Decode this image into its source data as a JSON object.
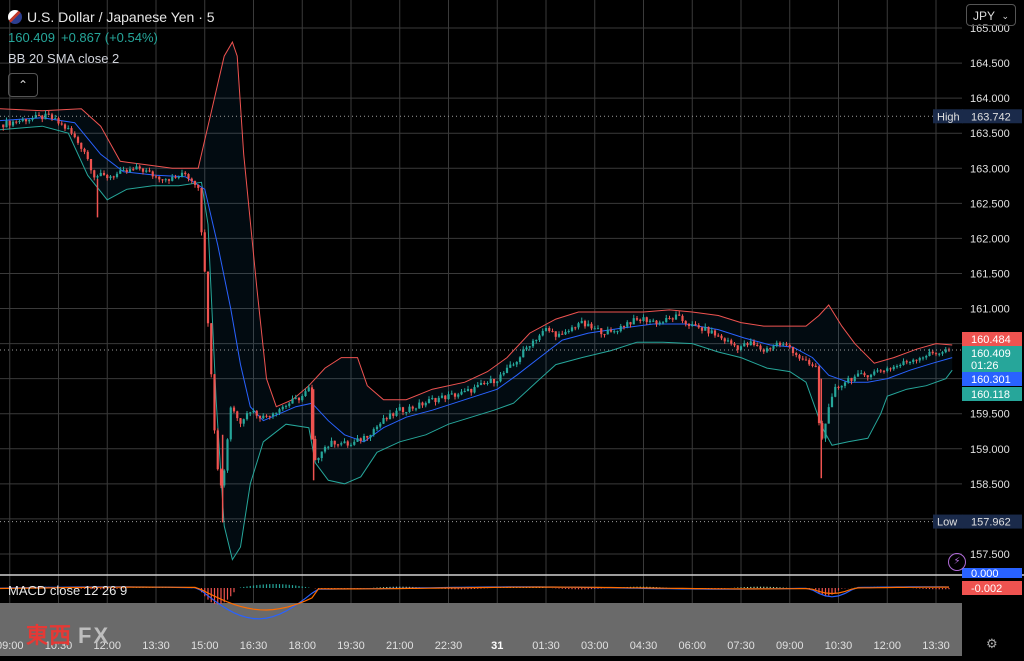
{
  "header": {
    "title": "U.S. Dollar / Japanese Yen · 5",
    "price": "160.409",
    "change": "+0.867 (+0.54%)",
    "indicator": "BB 20 SMA close 2",
    "collapse_icon": "chevron-up-icon"
  },
  "currency_selector": {
    "label": "JPY"
  },
  "macd_label": "MACD close 12 26 9",
  "logo": {
    "text": "東西",
    "fx": "FX"
  },
  "colors": {
    "up": "#26a69a",
    "down": "#ef5350",
    "upper_band": "#ef5350",
    "lower_band": "#26a69a",
    "basis": "#2962ff",
    "macd": "#2962ff",
    "signal": "#ff6d00"
  },
  "chart_data": {
    "type": "candlestick",
    "title": "U.S. Dollar / Japanese Yen · 5",
    "ylim": [
      157.2,
      165.4
    ],
    "y_ticks": [
      157.5,
      158.0,
      158.5,
      159.0,
      159.5,
      160.0,
      160.5,
      161.0,
      161.5,
      162.0,
      162.5,
      163.0,
      163.5,
      164.0,
      164.5,
      165.0
    ],
    "y_tick_labels": [
      "157.500",
      "158.000",
      "158.500",
      "159.000",
      "159.500",
      "160.000",
      "160.500",
      "161.000",
      "161.500",
      "162.000",
      "162.500",
      "163.000",
      "163.500",
      "164.000",
      "164.500",
      "165.000"
    ],
    "x_ticks": [
      {
        "label": "09:00",
        "pos": 0.0
      },
      {
        "label": "10:30",
        "pos": 1.5
      },
      {
        "label": "12:00",
        "pos": 3.0
      },
      {
        "label": "13:30",
        "pos": 4.5
      },
      {
        "label": "15:00",
        "pos": 6.0
      },
      {
        "label": "16:30",
        "pos": 7.5
      },
      {
        "label": "18:00",
        "pos": 9.0
      },
      {
        "label": "19:30",
        "pos": 10.5
      },
      {
        "label": "21:00",
        "pos": 12.0
      },
      {
        "label": "22:30",
        "pos": 13.5
      },
      {
        "label": "31",
        "pos": 15.0
      },
      {
        "label": "01:30",
        "pos": 16.5
      },
      {
        "label": "03:00",
        "pos": 18.0
      },
      {
        "label": "04:30",
        "pos": 19.5
      },
      {
        "label": "06:00",
        "pos": 21.0
      },
      {
        "label": "07:30",
        "pos": 22.5
      },
      {
        "label": "09:00",
        "pos": 24.0
      },
      {
        "label": "10:30",
        "pos": 25.5
      },
      {
        "label": "12:00",
        "pos": 27.0
      },
      {
        "label": "13:30",
        "pos": 28.5
      }
    ],
    "x_range": [
      -0.3,
      29.3
    ],
    "close_path": [
      [
        -0.3,
        163.62
      ],
      [
        0.5,
        163.7
      ],
      [
        1.2,
        163.74
      ],
      [
        1.8,
        163.55
      ],
      [
        2.3,
        163.25
      ],
      [
        2.6,
        162.9
      ],
      [
        3.0,
        162.88
      ],
      [
        3.6,
        162.95
      ],
      [
        4.0,
        163.0
      ],
      [
        4.5,
        162.88
      ],
      [
        5.0,
        162.85
      ],
      [
        5.4,
        162.92
      ],
      [
        5.8,
        162.75
      ],
      [
        6.0,
        161.5
      ],
      [
        6.15,
        160.5
      ],
      [
        6.3,
        159.3
      ],
      [
        6.45,
        158.4
      ],
      [
        6.6,
        158.7
      ],
      [
        6.8,
        159.6
      ],
      [
        7.1,
        159.4
      ],
      [
        7.4,
        159.55
      ],
      [
        7.8,
        159.45
      ],
      [
        8.2,
        159.55
      ],
      [
        8.6,
        159.65
      ],
      [
        9.0,
        159.75
      ],
      [
        9.2,
        159.85
      ],
      [
        9.35,
        158.75
      ],
      [
        9.6,
        159.0
      ],
      [
        10.0,
        159.1
      ],
      [
        10.5,
        159.05
      ],
      [
        11.0,
        159.2
      ],
      [
        11.5,
        159.4
      ],
      [
        12.0,
        159.55
      ],
      [
        12.5,
        159.6
      ],
      [
        13.0,
        159.7
      ],
      [
        13.5,
        159.75
      ],
      [
        14.0,
        159.8
      ],
      [
        14.5,
        159.9
      ],
      [
        15.0,
        160.0
      ],
      [
        15.5,
        160.2
      ],
      [
        16.0,
        160.5
      ],
      [
        16.5,
        160.7
      ],
      [
        17.0,
        160.6
      ],
      [
        17.5,
        160.8
      ],
      [
        18.0,
        160.7
      ],
      [
        18.5,
        160.65
      ],
      [
        19.0,
        160.8
      ],
      [
        19.5,
        160.85
      ],
      [
        20.0,
        160.8
      ],
      [
        20.5,
        160.88
      ],
      [
        21.0,
        160.75
      ],
      [
        21.5,
        160.68
      ],
      [
        22.0,
        160.55
      ],
      [
        22.4,
        160.45
      ],
      [
        22.8,
        160.5
      ],
      [
        23.2,
        160.4
      ],
      [
        23.6,
        160.5
      ],
      [
        24.0,
        160.45
      ],
      [
        24.4,
        160.25
      ],
      [
        24.8,
        160.15
      ],
      [
        24.95,
        159.0
      ],
      [
        25.1,
        159.4
      ],
      [
        25.4,
        159.85
      ],
      [
        25.8,
        160.0
      ],
      [
        26.3,
        160.05
      ],
      [
        26.8,
        160.12
      ],
      [
        27.3,
        160.18
      ],
      [
        27.8,
        160.28
      ],
      [
        28.3,
        160.35
      ],
      [
        28.8,
        160.4
      ],
      [
        29.0,
        160.41
      ]
    ],
    "upper_band": [
      [
        -0.3,
        163.85
      ],
      [
        1.0,
        163.82
      ],
      [
        2.2,
        163.85
      ],
      [
        2.8,
        163.6
      ],
      [
        3.4,
        163.1
      ],
      [
        4.2,
        163.05
      ],
      [
        5.0,
        163.0
      ],
      [
        5.8,
        163.0
      ],
      [
        6.2,
        163.8
      ],
      [
        6.6,
        164.6
      ],
      [
        6.85,
        164.8
      ],
      [
        7.0,
        164.6
      ],
      [
        7.2,
        163.2
      ],
      [
        7.6,
        161.3
      ],
      [
        7.9,
        160.0
      ],
      [
        8.2,
        159.6
      ],
      [
        8.7,
        159.7
      ],
      [
        9.2,
        159.9
      ],
      [
        9.7,
        160.15
      ],
      [
        10.2,
        160.3
      ],
      [
        10.7,
        160.3
      ],
      [
        11.0,
        159.9
      ],
      [
        11.5,
        159.7
      ],
      [
        12.2,
        159.7
      ],
      [
        13.0,
        159.85
      ],
      [
        14.0,
        159.95
      ],
      [
        14.7,
        160.1
      ],
      [
        15.3,
        160.3
      ],
      [
        16.0,
        160.65
      ],
      [
        16.8,
        160.85
      ],
      [
        17.5,
        160.95
      ],
      [
        18.5,
        160.95
      ],
      [
        19.5,
        160.95
      ],
      [
        20.3,
        160.98
      ],
      [
        21.0,
        160.95
      ],
      [
        21.8,
        160.9
      ],
      [
        22.5,
        160.8
      ],
      [
        23.2,
        160.75
      ],
      [
        24.0,
        160.75
      ],
      [
        24.5,
        160.75
      ],
      [
        24.9,
        160.9
      ],
      [
        25.2,
        161.05
      ],
      [
        25.6,
        160.75
      ],
      [
        26.0,
        160.5
      ],
      [
        26.6,
        160.22
      ],
      [
        27.2,
        160.3
      ],
      [
        27.9,
        160.42
      ],
      [
        28.5,
        160.5
      ],
      [
        29.0,
        160.48
      ]
    ],
    "lower_band": [
      [
        -0.3,
        163.55
      ],
      [
        1.0,
        163.6
      ],
      [
        1.8,
        163.5
      ],
      [
        2.4,
        162.9
      ],
      [
        3.0,
        162.55
      ],
      [
        3.6,
        162.7
      ],
      [
        4.4,
        162.75
      ],
      [
        5.2,
        162.75
      ],
      [
        5.9,
        162.8
      ],
      [
        6.1,
        162.2
      ],
      [
        6.35,
        159.7
      ],
      [
        6.6,
        157.9
      ],
      [
        6.85,
        157.42
      ],
      [
        7.1,
        157.6
      ],
      [
        7.4,
        158.5
      ],
      [
        7.8,
        159.1
      ],
      [
        8.5,
        159.35
      ],
      [
        9.2,
        159.3
      ],
      [
        9.4,
        158.8
      ],
      [
        9.8,
        158.55
      ],
      [
        10.3,
        158.5
      ],
      [
        10.8,
        158.6
      ],
      [
        11.3,
        158.95
      ],
      [
        12.0,
        159.1
      ],
      [
        12.8,
        159.2
      ],
      [
        13.5,
        159.35
      ],
      [
        14.2,
        159.45
      ],
      [
        14.9,
        159.55
      ],
      [
        15.5,
        159.65
      ],
      [
        16.2,
        159.95
      ],
      [
        16.8,
        160.2
      ],
      [
        17.6,
        160.3
      ],
      [
        18.5,
        160.4
      ],
      [
        19.3,
        160.52
      ],
      [
        20.1,
        160.52
      ],
      [
        21.0,
        160.5
      ],
      [
        21.8,
        160.38
      ],
      [
        22.5,
        160.3
      ],
      [
        23.3,
        160.15
      ],
      [
        24.0,
        160.1
      ],
      [
        24.5,
        159.95
      ],
      [
        25.0,
        159.3
      ],
      [
        25.3,
        159.05
      ],
      [
        25.8,
        159.1
      ],
      [
        26.4,
        159.15
      ],
      [
        26.8,
        159.5
      ],
      [
        27.0,
        159.75
      ],
      [
        27.6,
        159.85
      ],
      [
        28.2,
        159.9
      ],
      [
        28.8,
        160.0
      ],
      [
        29.0,
        160.12
      ]
    ],
    "basis": [
      [
        -0.3,
        163.68
      ],
      [
        1.0,
        163.72
      ],
      [
        2.0,
        163.65
      ],
      [
        2.8,
        163.2
      ],
      [
        3.5,
        162.95
      ],
      [
        4.5,
        162.9
      ],
      [
        5.4,
        162.88
      ],
      [
        6.0,
        162.7
      ],
      [
        6.4,
        161.9
      ],
      [
        6.8,
        161.0
      ],
      [
        7.1,
        160.2
      ],
      [
        7.4,
        159.6
      ],
      [
        7.8,
        159.4
      ],
      [
        8.3,
        159.5
      ],
      [
        8.8,
        159.6
      ],
      [
        9.3,
        159.65
      ],
      [
        9.8,
        159.4
      ],
      [
        10.3,
        159.2
      ],
      [
        10.9,
        159.1
      ],
      [
        11.5,
        159.3
      ],
      [
        12.2,
        159.45
      ],
      [
        13.0,
        159.55
      ],
      [
        14.0,
        159.7
      ],
      [
        15.0,
        159.85
      ],
      [
        15.6,
        160.05
      ],
      [
        16.3,
        160.3
      ],
      [
        17.0,
        160.55
      ],
      [
        17.8,
        160.65
      ],
      [
        18.8,
        160.72
      ],
      [
        19.8,
        160.78
      ],
      [
        20.8,
        160.78
      ],
      [
        21.8,
        160.7
      ],
      [
        22.6,
        160.58
      ],
      [
        23.4,
        160.48
      ],
      [
        24.1,
        160.45
      ],
      [
        24.7,
        160.3
      ],
      [
        25.2,
        160.05
      ],
      [
        25.8,
        159.95
      ],
      [
        26.4,
        159.95
      ],
      [
        27.0,
        160.0
      ],
      [
        27.7,
        160.12
      ],
      [
        28.4,
        160.22
      ],
      [
        29.0,
        160.3
      ]
    ],
    "spikes": [
      {
        "x": 2.7,
        "high": 162.85,
        "low": 162.3
      },
      {
        "x": 6.55,
        "high": 159.2,
        "low": 157.95
      },
      {
        "x": 9.35,
        "high": 159.85,
        "low": 158.55
      },
      {
        "x": 24.97,
        "high": 160.0,
        "low": 158.58
      }
    ],
    "high": {
      "label": "High",
      "value": "163.742",
      "y": 163.742
    },
    "low": {
      "label": "Low",
      "value": "157.962",
      "y": 157.962
    },
    "price_labels": [
      {
        "value": "160.484",
        "y": 160.484,
        "color": "#ef5350"
      },
      {
        "value": "160.409",
        "y": 160.409,
        "color": "#26a69a"
      },
      {
        "value": "01:26",
        "y": 160.409,
        "color": "#26a69a"
      },
      {
        "value": "160.301",
        "y": 160.301,
        "color": "#2962ff"
      },
      {
        "value": "160.118",
        "y": 160.118,
        "color": "#26a69a"
      }
    ],
    "current_price": 160.409,
    "macd": {
      "label": "MACD close 12 26 9",
      "value": "-0.002",
      "top_label": "0.000",
      "histogram_min": -0.8,
      "histogram_max": 0.3
    }
  }
}
